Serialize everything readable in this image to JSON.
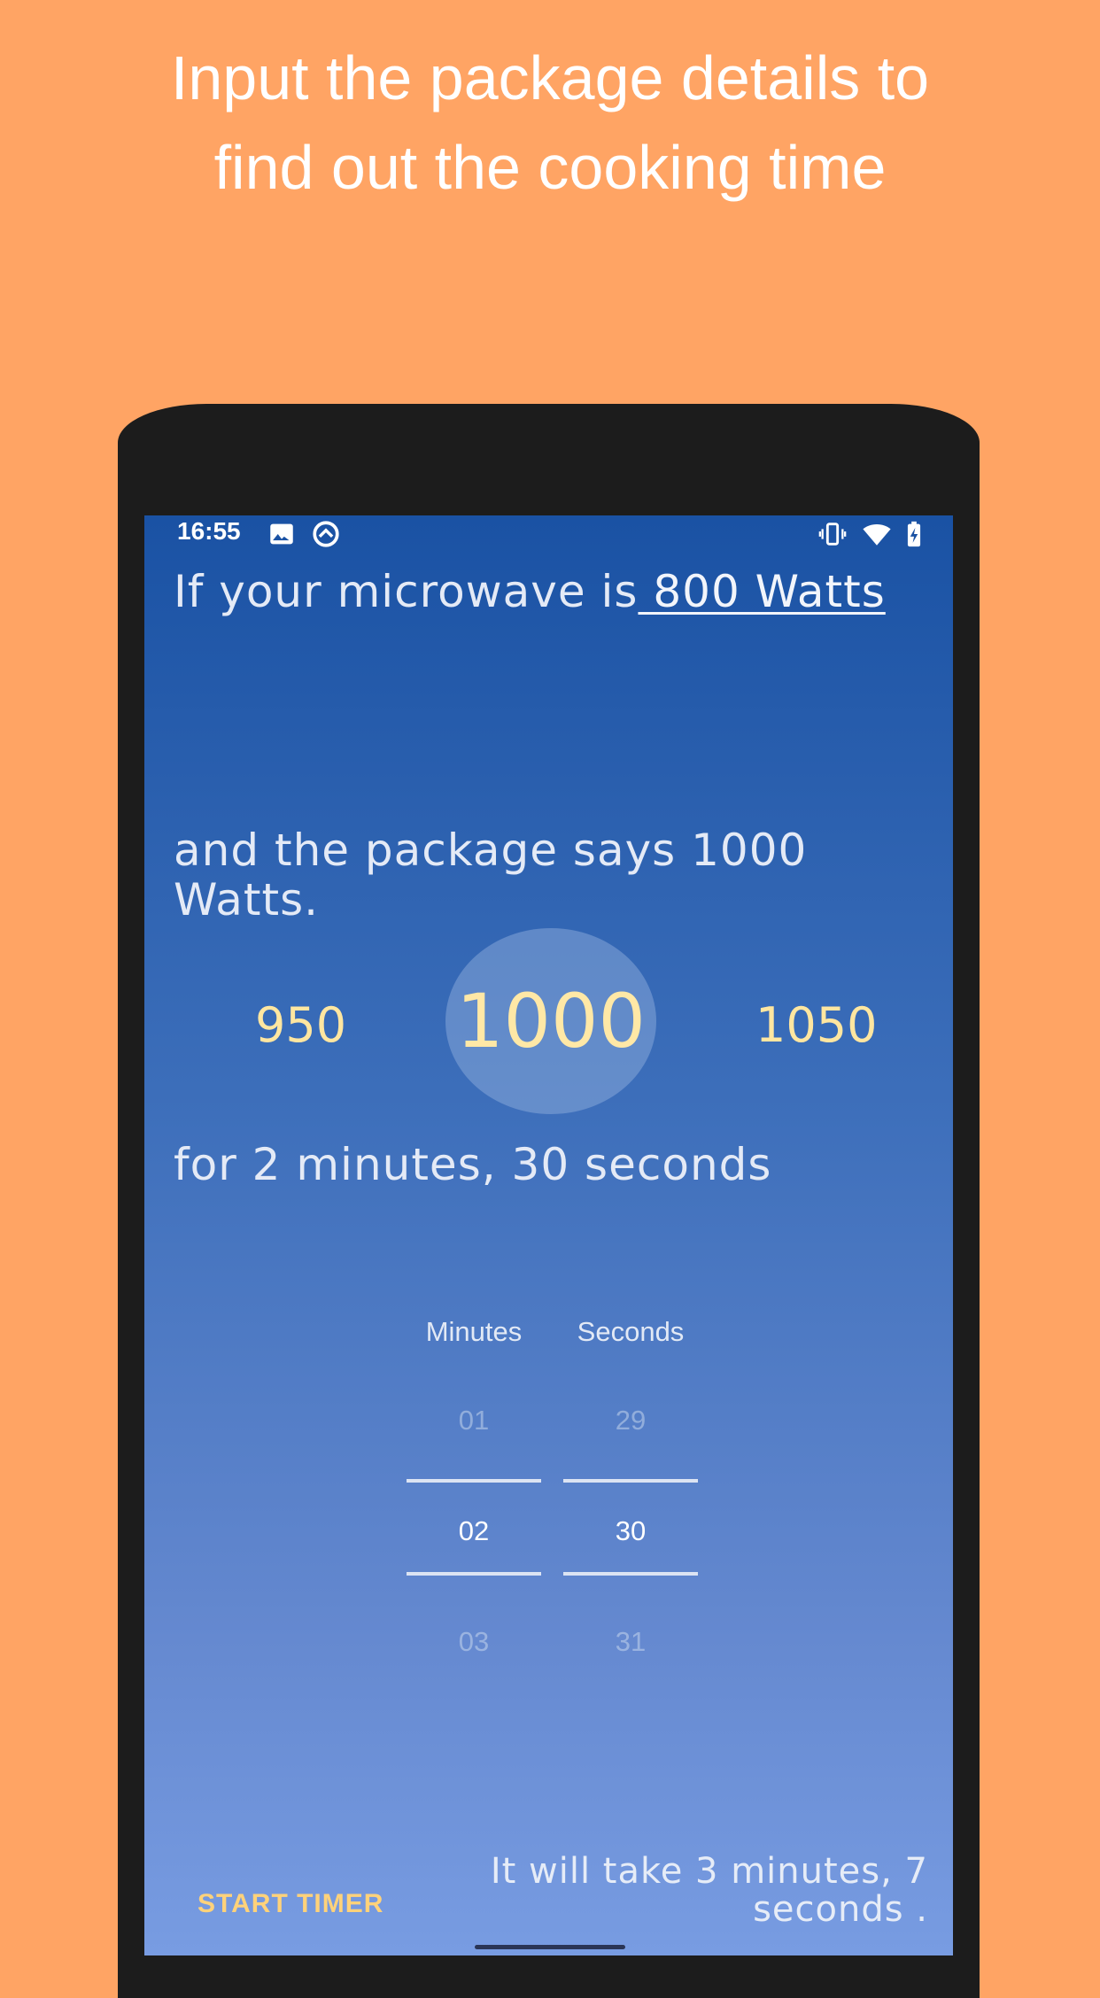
{
  "promo": {
    "heading": "Input the package details to find out the cooking time"
  },
  "status_bar": {
    "time": "16:55",
    "icons_left": [
      "image-icon",
      "data-saver-icon"
    ],
    "icons_right": [
      "vibrate-icon",
      "wifi-icon",
      "battery-charging-icon"
    ]
  },
  "microwave": {
    "prefix": "If your microwave is",
    "watts_link": " 800 Watts"
  },
  "package": {
    "text": "and the package says 1000 Watts."
  },
  "watt_picker": {
    "prev": "950",
    "selected": "1000",
    "next": "1050"
  },
  "duration": {
    "text": "for 2 minutes, 30 seconds"
  },
  "time_picker": {
    "minutes_label": "Minutes",
    "seconds_label": "Seconds",
    "minutes": {
      "prev": "01",
      "current": "02",
      "next": "03"
    },
    "seconds": {
      "prev": "29",
      "current": "30",
      "next": "31"
    }
  },
  "footer": {
    "start_timer_label": "START TIMER",
    "result": "It will take 3 minutes, 7 seconds ."
  },
  "colors": {
    "background": "#FFA464",
    "accent": "#FFD27A",
    "screen_top": "#1A52A4",
    "screen_bottom": "#789CE2"
  }
}
